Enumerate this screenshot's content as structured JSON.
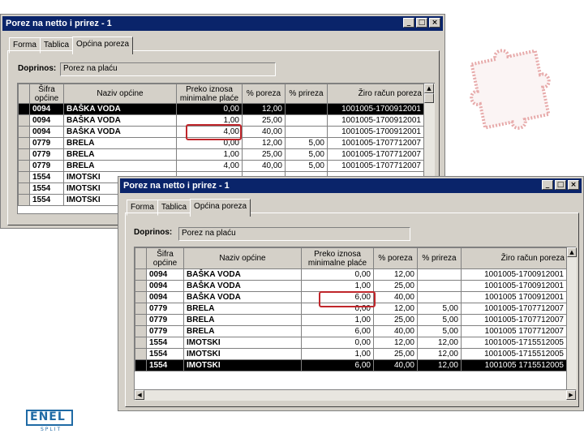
{
  "colors": {
    "title_bar": "#0a246a",
    "window_bg": "#d4d0c8",
    "highlight_box": "#c0262b",
    "logo": "#1f6aa5"
  },
  "window1": {
    "title": "Porez na netto i prirez - 1",
    "tabs": [
      "Forma",
      "Tablica",
      "Općina poreza"
    ],
    "doprinos_label": "Doprinos:",
    "doprinos_value": "Porez na plaću",
    "columns": [
      "Šifra općine",
      "Naziv općine",
      "Preko iznosa minimalne plaće",
      "% poreza",
      "% prireza",
      "Žiro račun poreza"
    ],
    "rows": [
      [
        "0094",
        "BAŠKA VODA",
        "0,00",
        "12,00",
        "",
        "1001005-1700912001"
      ],
      [
        "0094",
        "BAŠKA VODA",
        "1,00",
        "25,00",
        "",
        "1001005-1700912001"
      ],
      [
        "0094",
        "BAŠKA VODA",
        "4,00",
        "40,00",
        "",
        "1001005-1700912001"
      ],
      [
        "0779",
        "BRELA",
        "0,00",
        "12,00",
        "5,00",
        "1001005-1707712007"
      ],
      [
        "0779",
        "BRELA",
        "1,00",
        "25,00",
        "5,00",
        "1001005-1707712007"
      ],
      [
        "0779",
        "BRELA",
        "4,00",
        "40,00",
        "5,00",
        "1001005-1707712007"
      ],
      [
        "1554",
        "IMOTSKI",
        "",
        "",
        "",
        ""
      ],
      [
        "1554",
        "IMOTSKI",
        "",
        "",
        "",
        ""
      ],
      [
        "1554",
        "IMOTSKI",
        "",
        "",
        "",
        ""
      ]
    ]
  },
  "window2": {
    "title": "Porez na netto i prirez - 1",
    "tabs": [
      "Forma",
      "Tablica",
      "Općina poreza"
    ],
    "doprinos_label": "Doprinos:",
    "doprinos_value": "Porez na plaću",
    "columns": [
      "Šifra općine",
      "Naziv općine",
      "Preko iznosa minimalne plaće",
      "% poreza",
      "% prireza",
      "Žiro račun poreza"
    ],
    "rows": [
      [
        "0094",
        "BAŠKA VODA",
        "0,00",
        "12,00",
        "",
        "1001005-1700912001"
      ],
      [
        "0094",
        "BAŠKA VODA",
        "1,00",
        "25,00",
        "",
        "1001005-1700912001"
      ],
      [
        "0094",
        "BAŠKA VODA",
        "6,00",
        "40,00",
        "",
        "1001005 1700912001"
      ],
      [
        "0779",
        "BRELA",
        "0,00",
        "12,00",
        "5,00",
        "1001005-1707712007"
      ],
      [
        "0779",
        "BRELA",
        "1,00",
        "25,00",
        "5,00",
        "1001005-1707712007"
      ],
      [
        "0779",
        "BRELA",
        "6,00",
        "40,00",
        "5,00",
        "1001005 1707712007"
      ],
      [
        "1554",
        "IMOTSKI",
        "0,00",
        "12,00",
        "12,00",
        "1001005-1715512005"
      ],
      [
        "1554",
        "IMOTSKI",
        "1,00",
        "25,00",
        "12,00",
        "1001005-1715512005"
      ],
      [
        "1554",
        "IMOTSKI",
        "6,00",
        "40,00",
        "12,00",
        "1001005 1715512005"
      ]
    ]
  },
  "logo": {
    "text": "ENEL",
    "subtext": "SPLIT"
  }
}
